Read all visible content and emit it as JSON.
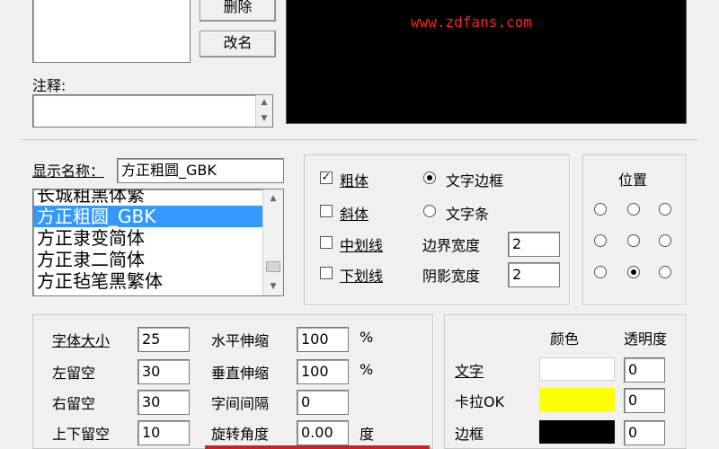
{
  "top": {
    "delete_label": "删除",
    "rename_label": "改名",
    "note_label": "注释:",
    "note_value": "",
    "preview_text": "www.zdfans.com"
  },
  "font_panel": {
    "display_name_label": "显示名称：",
    "display_name_value": "方正粗圆_GBK",
    "font_list": [
      "长城粗黑体繁",
      "方正粗圆_GBK",
      "方正隶变简体",
      "方正隶二简体",
      "方正毡笔黑繁体"
    ],
    "selected_index": 1
  },
  "style_panel": {
    "bold_label": "粗体",
    "bold_checked": true,
    "italic_label": "斜体",
    "italic_checked": false,
    "midline_label": "中划线",
    "midline_checked": false,
    "underline_label": "下划线",
    "underline_checked": false,
    "text_border_label": "文字边框",
    "text_border_selected": true,
    "text_bar_label": "文字条",
    "text_bar_selected": false,
    "border_width_label": "边界宽度",
    "border_width_value": "2",
    "shadow_width_label": "阴影宽度",
    "shadow_width_value": "2"
  },
  "position_panel": {
    "title": "位置",
    "selected_index": 7
  },
  "size_panel": {
    "font_size_label": "字体大小",
    "font_size_value": "25",
    "left_margin_label": "左留空",
    "left_margin_value": "30",
    "right_margin_label": "右留空",
    "right_margin_value": "30",
    "vertical_margin_label": "上下留空",
    "vertical_margin_value": "10",
    "h_stretch_label": "水平伸缩",
    "h_stretch_value": "100",
    "h_stretch_unit": "%",
    "v_stretch_label": "垂直伸缩",
    "v_stretch_value": "100",
    "v_stretch_unit": "%",
    "char_spacing_label": "字间间隔",
    "char_spacing_value": "0",
    "rotation_label": "旋转角度",
    "rotation_value": "0.00",
    "rotation_unit": "度"
  },
  "color_panel": {
    "color_header": "颜色",
    "opacity_header": "透明度",
    "rows": [
      {
        "label": "文字",
        "color": "#ffffff",
        "opacity": "0"
      },
      {
        "label": "卡拉OK",
        "color": "#ffff00",
        "opacity": "0"
      },
      {
        "label": "边框",
        "color": "#000000",
        "opacity": "0"
      }
    ]
  },
  "colors": {
    "preview_bg": "#000000",
    "preview_text": "#ff2020",
    "selection": "#3399ff",
    "accent_bar": "#d02020"
  }
}
